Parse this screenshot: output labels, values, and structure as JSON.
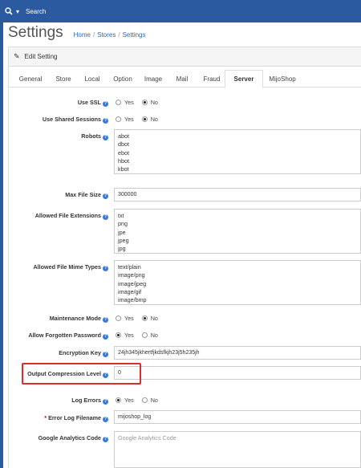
{
  "topbar": {
    "search_label": "Search"
  },
  "header": {
    "title": "Settings",
    "breadcrumb": [
      "Home",
      "Stores",
      "Settings"
    ],
    "separator": "/"
  },
  "panel": {
    "heading": "Edit Setting"
  },
  "tabs": [
    {
      "label": "General"
    },
    {
      "label": "Store"
    },
    {
      "label": "Local"
    },
    {
      "label": "Option"
    },
    {
      "label": "Image"
    },
    {
      "label": "Mail"
    },
    {
      "label": "Fraud"
    },
    {
      "label": "Server"
    },
    {
      "label": "MijoShop"
    }
  ],
  "active_tab": "Server",
  "form": {
    "use_ssl": {
      "label": "Use SSL",
      "options": [
        "Yes",
        "No"
      ],
      "selected": "No"
    },
    "use_shared_sessions": {
      "label": "Use Shared Sessions",
      "options": [
        "Yes",
        "No"
      ],
      "selected": "No"
    },
    "robots": {
      "label": "Robots",
      "lines": [
        "abot",
        "dbot",
        "ebot",
        "hbot",
        "kbot"
      ]
    },
    "max_file_size": {
      "label": "Max File Size",
      "value": "300000"
    },
    "allowed_extensions": {
      "label": "Allowed File Extensions",
      "lines": [
        "txt",
        "png",
        "jpe",
        "jpeg",
        "jpg"
      ]
    },
    "allowed_mime": {
      "label": "Allowed File Mime Types",
      "lines": [
        "text/plain",
        "image/png",
        "image/jpeg",
        "image/gif",
        "image/bmp"
      ]
    },
    "maintenance_mode": {
      "label": "Maintenance Mode",
      "options": [
        "Yes",
        "No"
      ],
      "selected": "No"
    },
    "allow_forgotten_password": {
      "label": "Allow Forgotten Password",
      "options": [
        "Yes",
        "No"
      ],
      "selected": "Yes"
    },
    "encryption_key": {
      "label": "Encryption Key",
      "value": "24jh345jkhertfjkdsfkjh23j5h235jh"
    },
    "output_compression": {
      "label": "Output Compression Level",
      "value": "0"
    },
    "log_errors": {
      "label": "Log Errors",
      "options": [
        "Yes",
        "No"
      ],
      "selected": "Yes"
    },
    "error_log_filename": {
      "label": "Error Log Filename",
      "required_mark": "*",
      "value": "mijoshop_log"
    },
    "google_analytics": {
      "label": "Google Analytics Code",
      "placeholder": "Google Analytics Code"
    }
  },
  "colors": {
    "topbar": "#2c5aa0",
    "link": "#2c6bb5",
    "help_icon": "#3a7bd5",
    "highlight": "#d9302c"
  }
}
